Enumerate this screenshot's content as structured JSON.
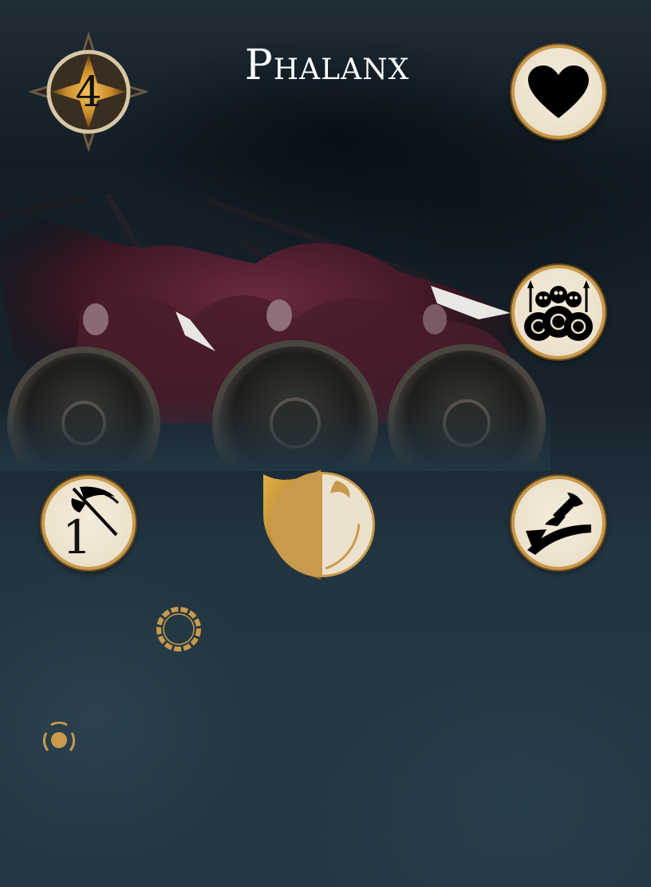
{
  "card": {
    "title": "Phalanx",
    "cost": "4",
    "attack_value": "1"
  },
  "icons": {
    "cost": "compass-star-icon",
    "health": "heart-icon",
    "unit_type": "skull-shield-phalanx-icon",
    "attack": "scythe-axe-icon",
    "faction": "half-shield-moon-icon",
    "ability": "sweeping-blade-icon",
    "ring_large": "ornate-ring-icon",
    "ring_small": "small-ring-icon"
  },
  "colors": {
    "gold": "#c89a4c",
    "token_bg": "#ece1cc",
    "background": "#1c2a33"
  }
}
